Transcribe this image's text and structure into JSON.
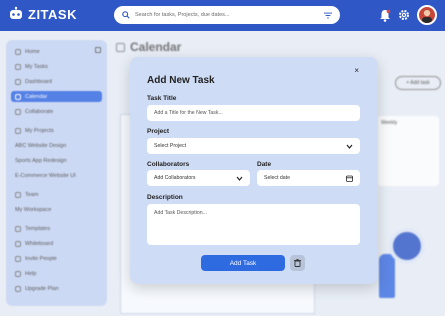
{
  "app": {
    "name": "ZITASK"
  },
  "search": {
    "placeholder": "Search for tasks, Projects, due dates..."
  },
  "sidebar": {
    "items": [
      {
        "label": "Home"
      },
      {
        "label": "My Tasks"
      },
      {
        "label": "Dashboard"
      },
      {
        "label": "Calendar"
      },
      {
        "label": "Collaborate"
      }
    ],
    "projects_header": "My Projects",
    "projects": [
      {
        "label": "ABC Website Design"
      },
      {
        "label": "Sports App Redesign"
      },
      {
        "label": "E-Commerce Website UI"
      }
    ],
    "team": "Team",
    "workspace": "My Workspace",
    "bottom": [
      {
        "label": "Templates"
      },
      {
        "label": "Whiteboard"
      },
      {
        "label": "Invite People"
      },
      {
        "label": "Help"
      },
      {
        "label": "Upgrade Plan"
      }
    ]
  },
  "main": {
    "title": "Calendar",
    "add_task_label": "+ Add task",
    "mini_calendar_label": "Weekly"
  },
  "modal": {
    "title": "Add New Task",
    "close_label": "×",
    "task_title_label": "Task Title",
    "task_title_placeholder": "Add a Title for the New Task...",
    "project_label": "Project",
    "project_value": "Select Project",
    "collaborators_label": "Collaborators",
    "collaborators_value": "Add Collaborators",
    "date_label": "Date",
    "date_value": "Select date",
    "description_label": "Description",
    "description_placeholder": "Add Task Description...",
    "submit_label": "Add Task"
  },
  "colors": {
    "brand": "#2f58c6",
    "accent": "#2f6be0",
    "modal_bg": "#cfdcf5"
  }
}
